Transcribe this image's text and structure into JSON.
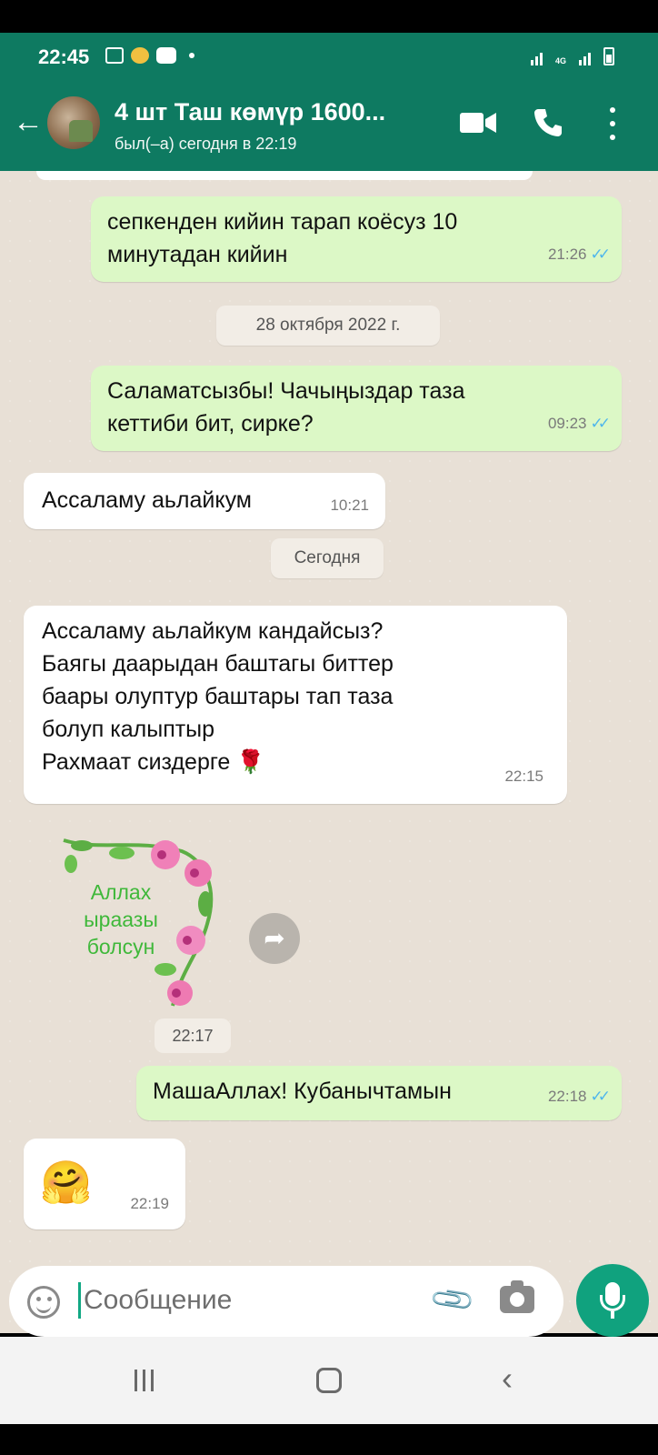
{
  "status_bar": {
    "time": "22:45",
    "network": "4G"
  },
  "header": {
    "contact_name": "4 шт Таш көмүр 1600...",
    "last_seen": "был(–а) сегодня в 22:19"
  },
  "messages": [
    {
      "direction": "out",
      "lines": [
        "сепкенден кийин тарап коёсуз 10",
        "минутадан кийин"
      ],
      "time": "21:26",
      "read": true
    },
    {
      "type": "date",
      "text": "28 октября 2022 г."
    },
    {
      "direction": "out",
      "lines": [
        "Саламатсызбы! Чачыңыздар таза",
        "кеттиби бит, сирке?"
      ],
      "time": "09:23",
      "read": true
    },
    {
      "direction": "in",
      "lines": [
        "Ассаламу аьлайкум"
      ],
      "time": "10:21"
    },
    {
      "type": "date",
      "text": "Сегодня"
    },
    {
      "direction": "in",
      "lines": [
        "Ассаламу аьлайкум кандайсыз?",
        "Баягы даарыдан баштагы биттер",
        "баары олуптур баштары тап таза",
        "болуп калыптыр",
        "Рахмаат сиздерге 🌹"
      ],
      "time": "22:15"
    },
    {
      "type": "sticker",
      "text_lines": [
        "Аллах",
        "ыраазы",
        "болсун"
      ],
      "time": "22:17"
    },
    {
      "direction": "out",
      "lines": [
        "МашаАллах! Кубанычтамын"
      ],
      "time": "22:18",
      "read": true
    },
    {
      "direction": "in",
      "lines": [
        "🤗"
      ],
      "time": "22:19"
    }
  ],
  "input": {
    "placeholder": "Сообщение"
  },
  "colors": {
    "header": "#0e7a61",
    "outgoing_bubble": "#dcf8c6",
    "incoming_bubble": "#ffffff",
    "read_ticks": "#4fb6ec",
    "mic_button": "#10a27e"
  }
}
